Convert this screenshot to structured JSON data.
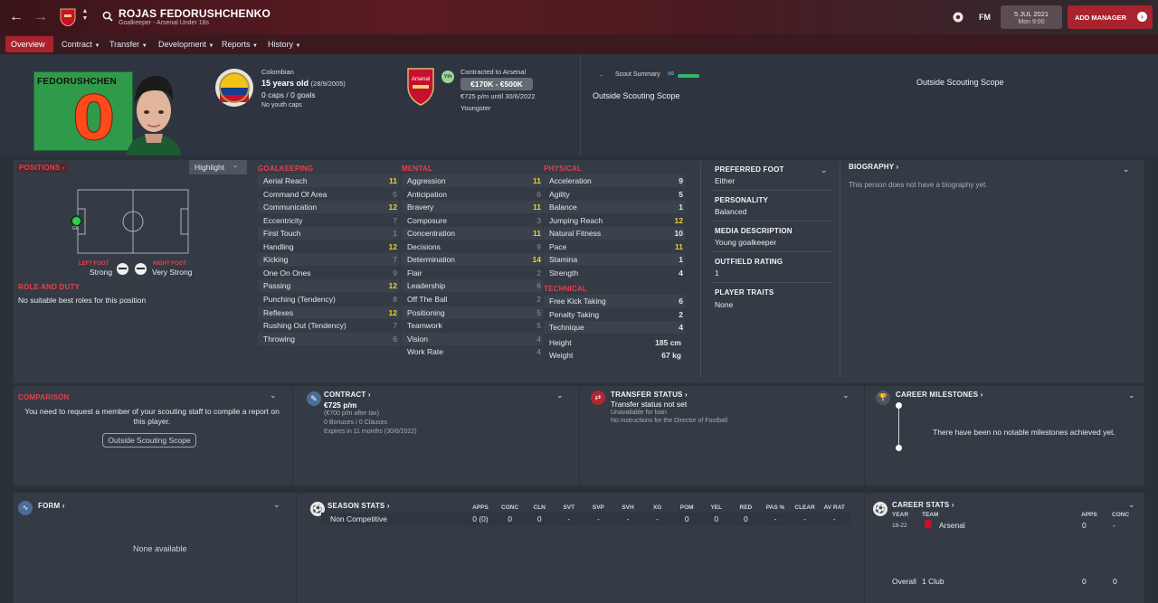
{
  "header": {
    "player_name": "ROJAS FEDORUSHCHENKO",
    "subtitle": "Goalkeeper - Arsenal Under 18s",
    "fm_label": "FM",
    "date": "5 JUL 2021",
    "day_time": "Mon 9:00",
    "add_manager": "ADD MANAGER",
    "accent": "#a8232e"
  },
  "nav": {
    "tabs": [
      "Overview",
      "Contract",
      "Transfer",
      "Development",
      "Reports",
      "History"
    ]
  },
  "profile": {
    "shirt_name": "FEDORUSHCHEN",
    "shirt_number": "0",
    "nationality": "Colombian",
    "age": "15 years old",
    "dob": "(28/9/2005)",
    "caps": "0 caps / 0 goals",
    "youth_caps": "No youth caps",
    "contracted": "Contracted to Arsenal",
    "yth_badge": "Yth",
    "value": "€170K - €500K",
    "wage_until": "€725 p/m until 30/6/2022",
    "status": "Youngster",
    "scout_label": "Scout Summary",
    "scout_dash": "-",
    "scout_scope": "Outside Scouting Scope",
    "scout_scope_right": "Outside Scouting Scope"
  },
  "positions": {
    "title": "POSITIONS",
    "highlight": "Highlight",
    "gk": "GK",
    "left_foot_label": "LEFT FOOT",
    "left_foot": "Strong",
    "right_foot_label": "RIGHT FOOT",
    "right_foot": "Very Strong",
    "role_title": "ROLE AND DUTY",
    "role_text": "No suitable best roles for this position"
  },
  "goalkeeping": {
    "title": "GOALKEEPING",
    "attrs": [
      {
        "name": "Aerial Reach",
        "value": "11",
        "hl": true
      },
      {
        "name": "Command Of Area",
        "value": "5",
        "hl": false
      },
      {
        "name": "Communication",
        "value": "12",
        "hl": true
      },
      {
        "name": "Eccentricity",
        "value": "7",
        "hl": false
      },
      {
        "name": "First Touch",
        "value": "1",
        "hl": false
      },
      {
        "name": "Handling",
        "value": "12",
        "hl": true
      },
      {
        "name": "Kicking",
        "value": "7",
        "hl": false
      },
      {
        "name": "One On Ones",
        "value": "9",
        "hl": false
      },
      {
        "name": "Passing",
        "value": "12",
        "hl": true
      },
      {
        "name": "Punching (Tendency)",
        "value": "8",
        "hl": false
      },
      {
        "name": "Reflexes",
        "value": "12",
        "hl": true
      },
      {
        "name": "Rushing Out (Tendency)",
        "value": "7",
        "hl": false
      },
      {
        "name": "Throwing",
        "value": "6",
        "hl": false
      }
    ]
  },
  "mental": {
    "title": "MENTAL",
    "attrs": [
      {
        "name": "Aggression",
        "value": "11",
        "hl": true
      },
      {
        "name": "Anticipation",
        "value": "6",
        "hl": false
      },
      {
        "name": "Bravery",
        "value": "11",
        "hl": true
      },
      {
        "name": "Composure",
        "value": "3",
        "hl": false
      },
      {
        "name": "Concentration",
        "value": "11",
        "hl": true
      },
      {
        "name": "Decisions",
        "value": "9",
        "hl": false
      },
      {
        "name": "Determination",
        "value": "14",
        "hl": true
      },
      {
        "name": "Flair",
        "value": "2",
        "hl": false
      },
      {
        "name": "Leadership",
        "value": "6",
        "hl": false
      },
      {
        "name": "Off The Ball",
        "value": "2",
        "hl": false
      },
      {
        "name": "Positioning",
        "value": "5",
        "hl": false
      },
      {
        "name": "Teamwork",
        "value": "5",
        "hl": false
      },
      {
        "name": "Vision",
        "value": "4",
        "hl": false
      },
      {
        "name": "Work Rate",
        "value": "4",
        "hl": false
      }
    ]
  },
  "physical": {
    "title": "PHYSICAL",
    "attrs": [
      {
        "name": "Acceleration",
        "value": "9",
        "hl": false
      },
      {
        "name": "Agility",
        "value": "5",
        "hl": false
      },
      {
        "name": "Balance",
        "value": "1",
        "hl": false
      },
      {
        "name": "Jumping Reach",
        "value": "12",
        "hl": true
      },
      {
        "name": "Natural Fitness",
        "value": "10",
        "hl": false
      },
      {
        "name": "Pace",
        "value": "11",
        "hl": true
      },
      {
        "name": "Stamina",
        "value": "1",
        "hl": false
      },
      {
        "name": "Strength",
        "value": "4",
        "hl": false
      }
    ]
  },
  "technical": {
    "title": "TECHNICAL",
    "attrs": [
      {
        "name": "Free Kick Taking",
        "value": "6",
        "hl": false
      },
      {
        "name": "Penalty Taking",
        "value": "2",
        "hl": false
      },
      {
        "name": "Technique",
        "value": "4",
        "hl": false
      }
    ],
    "height_label": "Height",
    "height": "185 cm",
    "weight_label": "Weight",
    "weight": "67 kg"
  },
  "info": {
    "pref_foot_label": "PREFERRED FOOT",
    "pref_foot": "Either",
    "personality_label": "PERSONALITY",
    "personality": "Balanced",
    "media_label": "MEDIA DESCRIPTION",
    "media": "Young goalkeeper",
    "outfield_label": "OUTFIELD RATING",
    "outfield": "1",
    "traits_label": "PLAYER TRAITS",
    "traits": "None"
  },
  "biography": {
    "title": "BIOGRAPHY",
    "text": "This person does not have a biography yet."
  },
  "comparison": {
    "title": "COMPARISON",
    "text": "You need to request a member of your scouting staff to compile a report on this player.",
    "button": "Outside Scouting Scope"
  },
  "contract": {
    "title": "CONTRACT",
    "wage": "€725 p/m",
    "after_tax": "(€700 p/m after tax)",
    "bonuses": "0 Bonuses / 0 Clauses",
    "expires": "Expires in 11 months  (30/6/2022)"
  },
  "transfer": {
    "title": "TRANSFER STATUS",
    "status": "Transfer status not set",
    "loan": "Unavailable for loan",
    "dof": "No instructions for the Director of Football"
  },
  "milestones": {
    "title": "CAREER MILESTONES",
    "text": "There have been no notable milestones achieved yet."
  },
  "form": {
    "title": "FORM",
    "text": "None available"
  },
  "season_stats": {
    "title": "SEASON STATS",
    "headers": [
      "APPS",
      "CONC",
      "CLN",
      "SVT",
      "SVP",
      "SVH",
      "XG",
      "POM",
      "YEL",
      "RED",
      "PAS %",
      "CLEAR",
      "AV RAT"
    ],
    "row_label": "Non Competitive",
    "row": [
      "0 (0)",
      "0",
      "0",
      "-",
      "-",
      "-",
      "-",
      "0",
      "0",
      "0",
      "-",
      "-",
      "-"
    ]
  },
  "career_stats": {
    "title": "CAREER STATS",
    "h_year": "YEAR",
    "h_team": "TEAM",
    "h_apps": "APPS",
    "h_conc": "CONC",
    "year": "18-22",
    "team": "Arsenal",
    "apps": "0",
    "conc": "-",
    "overall": "Overall",
    "clubs": "1 Club",
    "o_apps": "0",
    "o_conc": "0"
  }
}
